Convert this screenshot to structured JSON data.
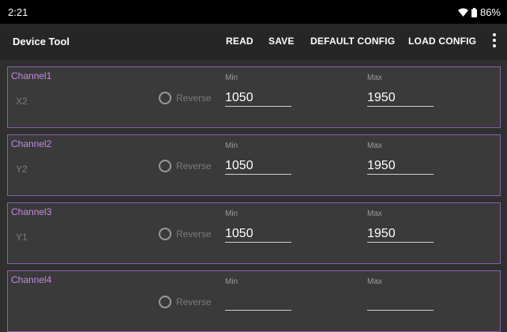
{
  "status_bar": {
    "time": "2:21",
    "battery": "86%",
    "icons": [
      "wifi-icon",
      "battery-icon"
    ]
  },
  "app_bar": {
    "title": "Device Tool",
    "actions": [
      "READ",
      "SAVE",
      "DEFAULT CONFIG",
      "LOAD CONFIG"
    ],
    "overflow_icon": "more-vert-icon"
  },
  "labels": {
    "reverse": "Reverse",
    "min": "Min",
    "max": "Max"
  },
  "channels": [
    {
      "title": "Channel1",
      "name": "X2",
      "min": "1050",
      "max": "1950"
    },
    {
      "title": "Channel2",
      "name": "Y2",
      "min": "1050",
      "max": "1950"
    },
    {
      "title": "Channel3",
      "name": "Y1",
      "min": "1050",
      "max": "1950"
    },
    {
      "title": "Channel4",
      "name": "",
      "min": "",
      "max": ""
    }
  ],
  "colors": {
    "accent": "#c389e2",
    "card_border": "#8c5cab",
    "background": "#2f2f2f",
    "card": "#3a3a3a"
  }
}
